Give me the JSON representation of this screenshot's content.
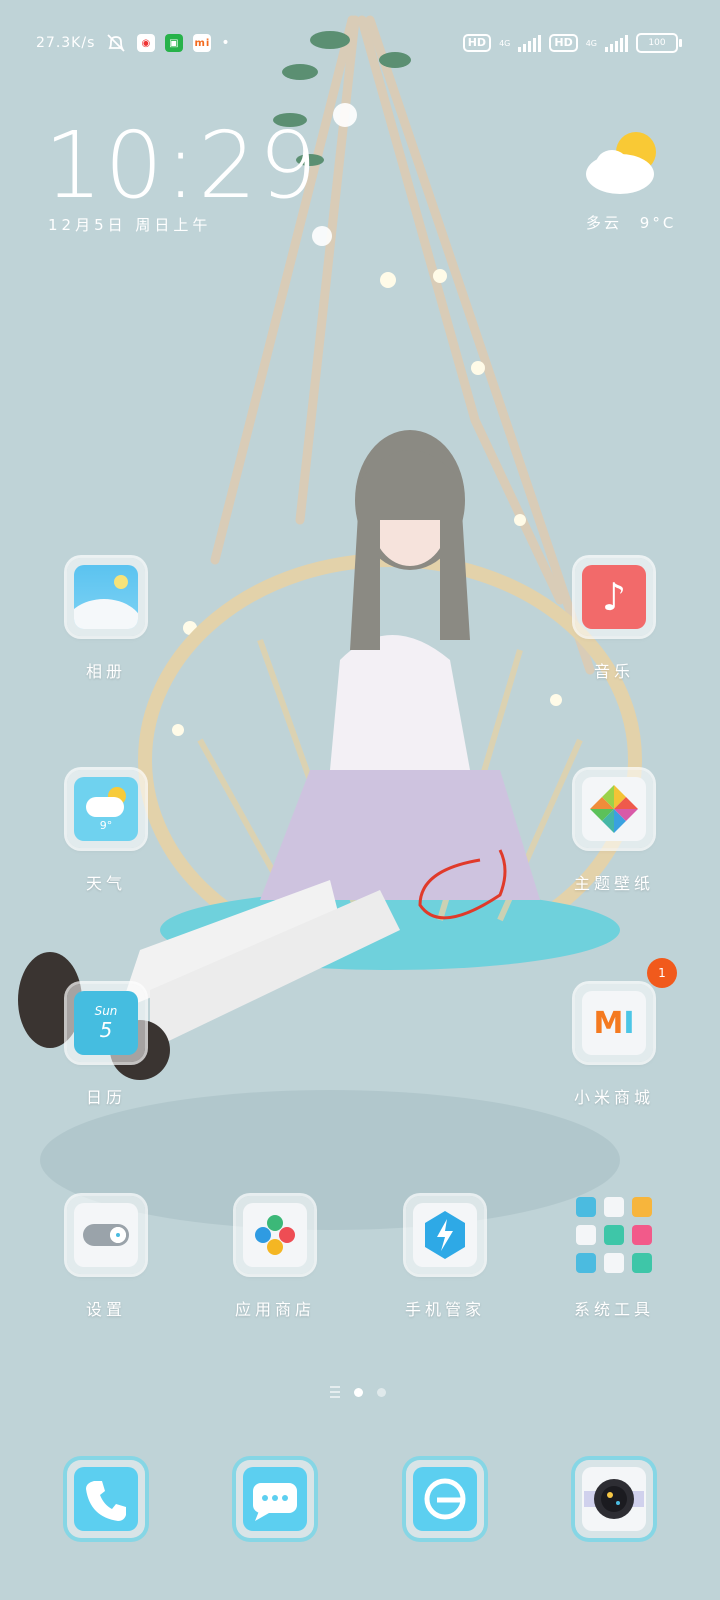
{
  "status_bar": {
    "net_speed": "27.3K/s",
    "hd1": "HD",
    "hd2": "HD",
    "network1": "4G",
    "network2": "4G",
    "battery": "100"
  },
  "clock": {
    "time": "10:29",
    "date": "12月5日 周日上午"
  },
  "weather": {
    "condition": "多云",
    "temperature": "9°C"
  },
  "apps": {
    "photos": "相册",
    "music": "音乐",
    "weather": "天气",
    "weather_tile_temp": "9°",
    "themes": "主题壁纸",
    "calendar": "日历",
    "calendar_day": "Sun",
    "calendar_date": "5",
    "mi_store": "小米商城",
    "mi_store_badge": "1",
    "settings": "设置",
    "app_store": "应用商店",
    "security": "手机管家",
    "tools": "系统工具"
  },
  "dock": [
    "phone",
    "messages",
    "browser",
    "camera"
  ],
  "pager": {
    "pages": 2,
    "active": 1
  },
  "colors": {
    "background": "#bfd3d7",
    "dock_glow": "#6ed7eb",
    "music_red": "#f26a6a",
    "badge": "#f15a1c"
  }
}
